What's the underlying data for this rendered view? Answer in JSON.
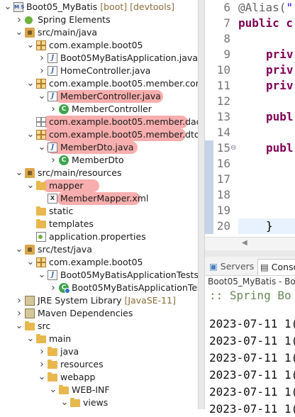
{
  "explorer": {
    "rows": [
      {
        "label": "Boot05_MyBatis",
        "decoration": "[boot] [devtools]",
        "icon": "project-icon"
      },
      {
        "label": "Spring Elements",
        "decoration": "",
        "icon": "spring-icon"
      },
      {
        "label": "src/main/java",
        "decoration": "",
        "icon": "source-folder-icon"
      },
      {
        "label": "com.example.boot05",
        "decoration": "",
        "icon": "package-icon"
      },
      {
        "label": "Boot05MyBatisApplication.java",
        "decoration": "",
        "icon": "java-file-icon"
      },
      {
        "label": "HomeController.java",
        "decoration": "",
        "icon": "java-file-icon"
      },
      {
        "label": "com.example.boot05.member.contro",
        "decoration": "",
        "icon": "package-icon"
      },
      {
        "label": "MemberController.java",
        "decoration": "",
        "icon": "java-file-icon"
      },
      {
        "label": "MemberController",
        "decoration": "",
        "icon": "class-icon"
      },
      {
        "label": "com.example.boot05.member.dao",
        "decoration": "",
        "icon": "empty-package-icon"
      },
      {
        "label": "com.example.boot05.member.dto",
        "decoration": "",
        "icon": "package-icon"
      },
      {
        "label": "MemberDto.java",
        "decoration": "",
        "icon": "java-file-icon"
      },
      {
        "label": "MemberDto",
        "decoration": "",
        "icon": "class-icon"
      },
      {
        "label": "src/main/resources",
        "decoration": "",
        "icon": "source-folder-icon"
      },
      {
        "label": "mapper",
        "decoration": "",
        "icon": "folder-icon"
      },
      {
        "label": "MemberMapper.xml",
        "decoration": "",
        "icon": "xml-file-icon"
      },
      {
        "label": "static",
        "decoration": "",
        "icon": "folder-icon"
      },
      {
        "label": "templates",
        "decoration": "",
        "icon": "folder-icon"
      },
      {
        "label": "application.properties",
        "decoration": "",
        "icon": "properties-file-icon"
      },
      {
        "label": "src/test/java",
        "decoration": "",
        "icon": "source-folder-icon"
      },
      {
        "label": "com.example.boot05",
        "decoration": "",
        "icon": "package-icon"
      },
      {
        "label": "Boot05MyBatisApplicationTests.ja",
        "decoration": "",
        "icon": "java-file-icon"
      },
      {
        "label": "Boot05MyBatisApplicationTest",
        "decoration": "",
        "icon": "test-class-icon"
      },
      {
        "label": "JRE System Library",
        "decoration": "[JavaSE-11]",
        "icon": "library-icon"
      },
      {
        "label": "Maven Dependencies",
        "decoration": "",
        "icon": "library-icon"
      },
      {
        "label": "src",
        "decoration": "",
        "icon": "folder-icon"
      },
      {
        "label": "main",
        "decoration": "",
        "icon": "folder-icon"
      },
      {
        "label": "java",
        "decoration": "",
        "icon": "folder-icon"
      },
      {
        "label": "resources",
        "decoration": "",
        "icon": "folder-icon"
      },
      {
        "label": "webapp",
        "decoration": "",
        "icon": "folder-icon"
      },
      {
        "label": "WEB-INF",
        "decoration": "",
        "icon": "folder-icon"
      },
      {
        "label": "views",
        "decoration": "",
        "icon": "folder-icon"
      }
    ]
  },
  "editor": {
    "line_numbers": [
      "6",
      "7",
      "8",
      "9",
      "10",
      "11",
      "12",
      "13",
      "14",
      "15",
      "16",
      "17",
      "18",
      "19",
      "20"
    ],
    "lines": {
      "l6_ann": "@Alias(",
      "l6_str": "\"",
      "l7_kw": "public c",
      "l9": "priv",
      "l10": "priv",
      "l11": "priv",
      "l13": "publ",
      "l15": "publ",
      "l20": "}"
    },
    "fold_marker": "⊖"
  },
  "console": {
    "tabs": [
      "Servers",
      "Conso"
    ],
    "title": "Boot05_MyBatis - Boot",
    "lines": [
      ":: Spring Bo",
      "2023-07-11 1(",
      "2023-07-11 1(",
      "2023-07-11 1(",
      "2023-07-11 1(",
      "2023-07-11 1(",
      "2023-07-11 1("
    ]
  },
  "colors": {
    "highlight": "#f26b6b",
    "keyword": "#7f0055",
    "annotation": "#646464",
    "string": "#2a00ff"
  }
}
